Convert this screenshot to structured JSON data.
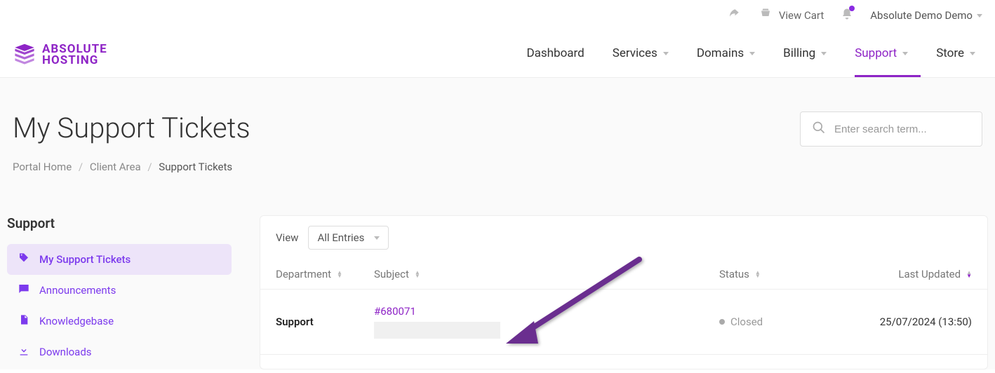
{
  "topbar": {
    "cart_label": "View Cart",
    "user_name": "Absolute Demo Demo"
  },
  "logo": {
    "line1": "ABSOLUTE",
    "line2": "HOSTING"
  },
  "nav": {
    "dashboard": "Dashboard",
    "services": "Services",
    "domains": "Domains",
    "billing": "Billing",
    "support": "Support",
    "store": "Store"
  },
  "page": {
    "title": "My Support Tickets",
    "search_placeholder": "Enter search term..."
  },
  "breadcrumb": {
    "home": "Portal Home",
    "client": "Client Area",
    "current": "Support Tickets"
  },
  "sidebar": {
    "heading": "Support",
    "items": [
      {
        "label": "My Support Tickets"
      },
      {
        "label": "Announcements"
      },
      {
        "label": "Knowledgebase"
      },
      {
        "label": "Downloads"
      }
    ]
  },
  "table": {
    "view_label": "View",
    "view_value": "All Entries",
    "columns": {
      "department": "Department",
      "subject": "Subject",
      "status": "Status",
      "updated": "Last Updated"
    },
    "rows": [
      {
        "department": "Support",
        "ticket_id": "#680071",
        "status": "Closed",
        "updated": "25/07/2024 (13:50)"
      }
    ]
  }
}
